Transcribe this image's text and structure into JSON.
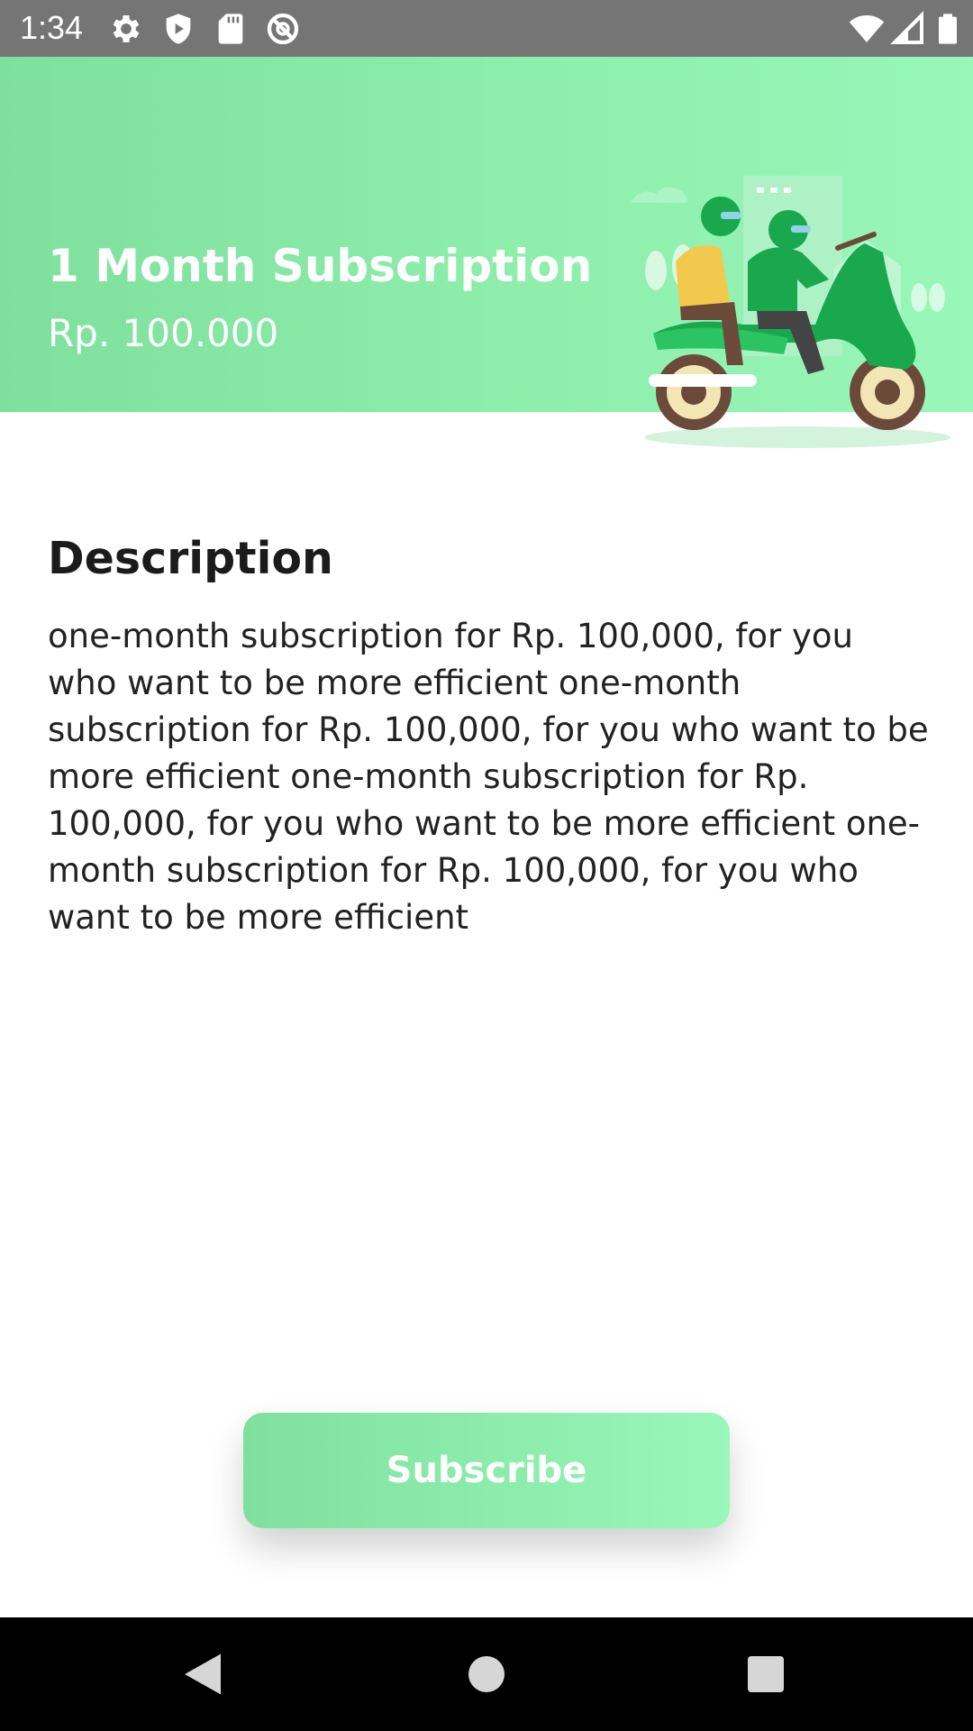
{
  "status_bar": {
    "time": "1:34",
    "left_icons": [
      "gear-icon",
      "shield-icon",
      "sd-card-icon",
      "no-sync-icon"
    ],
    "right_icons": [
      "wifi-icon",
      "signal-icon",
      "battery-icon"
    ]
  },
  "header": {
    "title": "1 Month Subscription",
    "price": "Rp. 100.000",
    "illustration": "motorbike-riders-illustration",
    "colors": {
      "gradient_start": "#7fe09e",
      "gradient_end": "#98f7b9"
    }
  },
  "description": {
    "heading": "Description",
    "body": "one-month subscription for Rp. 100,000, for you who want to be more efficient one-month subscription for Rp. 100,000, for you who want to be more efficient one-month subscription for Rp. 100,000, for you who want to be more efficient one-month subscription for Rp. 100,000, for you who want to be more efficient"
  },
  "subscribe": {
    "label": "Subscribe"
  },
  "nav_bar": {
    "buttons": [
      "back-icon",
      "home-icon",
      "recents-icon"
    ]
  }
}
